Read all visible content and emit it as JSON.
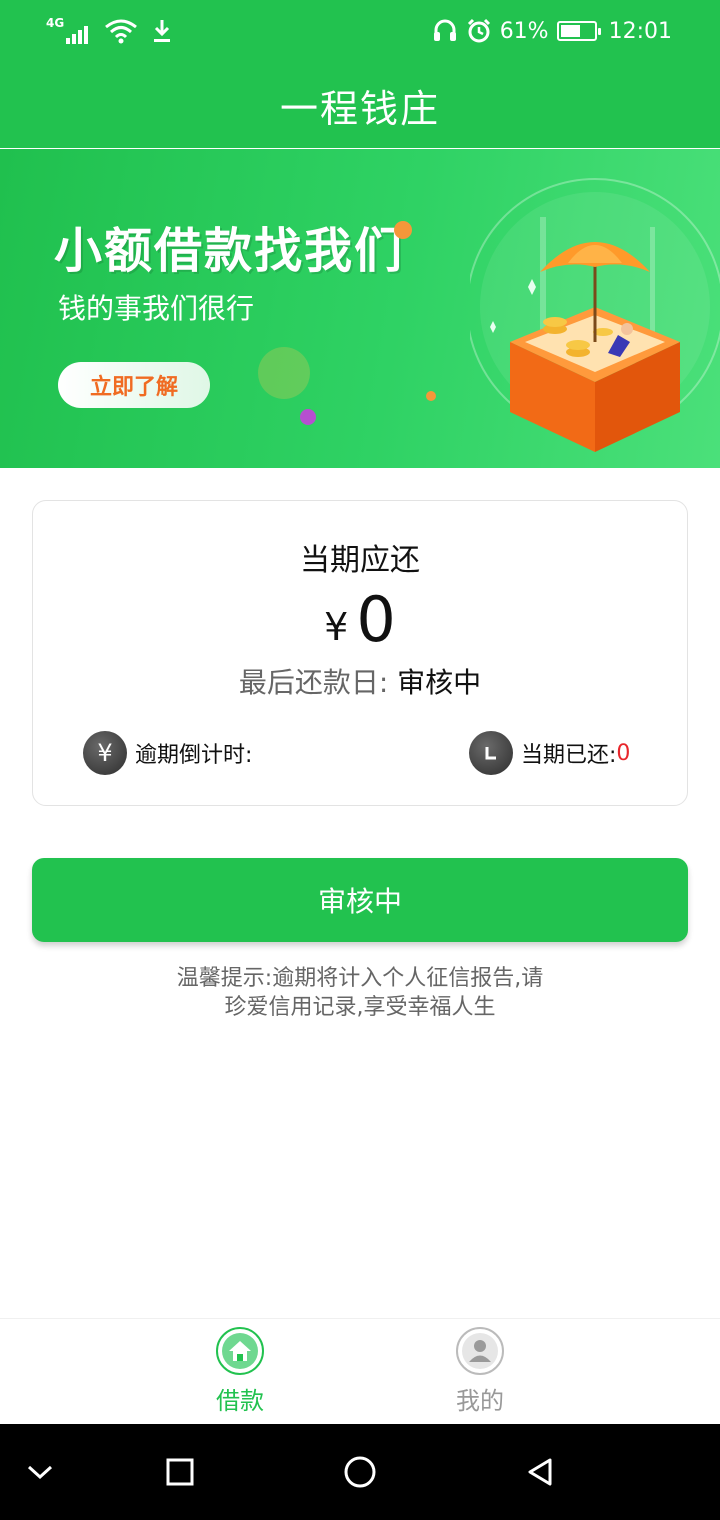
{
  "status_bar": {
    "network": "4G",
    "battery": "61%",
    "battery_level": 0.61,
    "time": "12:01"
  },
  "header": {
    "title": "一程钱庄"
  },
  "banner": {
    "headline": "小额借款找我们",
    "subline": "钱的事我们很行",
    "cta": "立即了解"
  },
  "card": {
    "title": "当期应还",
    "currency": "¥",
    "amount": "0",
    "due_label": "最后还款日:",
    "due_value": "审核中",
    "overdue_label": "逾期倒计时:",
    "overdue_icon_glyph": "¥",
    "paid_label": "当期已还:",
    "paid_value": "0"
  },
  "main_button": {
    "label": "审核中"
  },
  "tip": {
    "line1": "温馨提示:逾期将计入个人征信报告,请",
    "line2": "珍爱信用记录,享受幸福人生"
  },
  "tabbar": {
    "tabs": [
      {
        "label": "借款",
        "icon": "home-icon",
        "active": true
      },
      {
        "label": "我的",
        "icon": "user-icon",
        "active": false
      }
    ]
  },
  "nav": {
    "icons": [
      "chevron-down-icon",
      "recent-apps-icon",
      "home-circle-icon",
      "back-icon"
    ]
  },
  "colors": {
    "brand_green": "#22c24f",
    "accent_orange": "#f06b22",
    "alert_red": "#e8262b"
  }
}
